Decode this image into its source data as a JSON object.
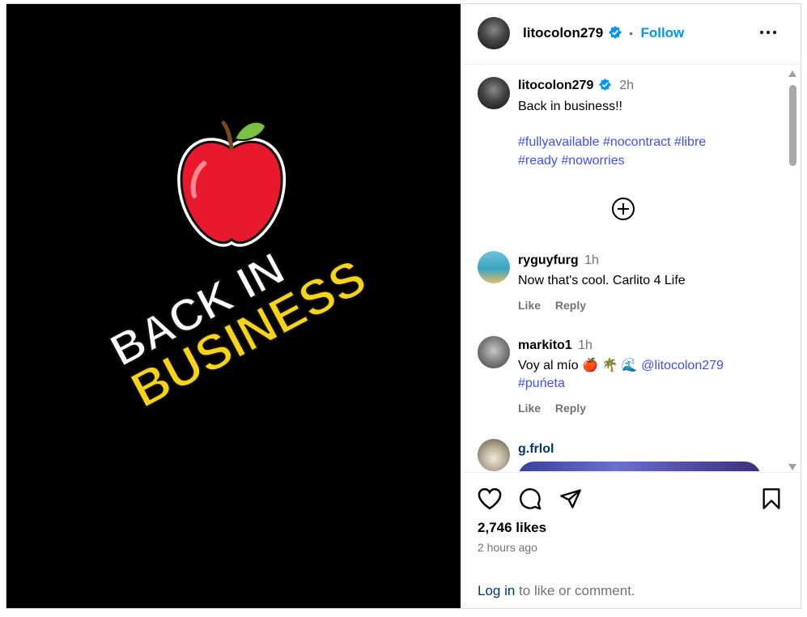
{
  "post": {
    "image_text_line1": "BACK IN",
    "image_text_line2": "BUSINESS"
  },
  "header": {
    "username": "litocolon279",
    "separator": "•",
    "follow_label": "Follow"
  },
  "caption": {
    "username": "litocolon279",
    "time": "2h",
    "text": "Back in business!!",
    "hashtags_line1": [
      "#fullyavailable",
      "#nocontract",
      "#libre"
    ],
    "hashtags_line2": [
      "#ready",
      "#noworries"
    ]
  },
  "comments": [
    {
      "username": "ryguyfurg",
      "time": "1h",
      "text": "Now that's cool. Carlito 4 Life",
      "like_label": "Like",
      "reply_label": "Reply"
    },
    {
      "username": "markito1",
      "time": "1h",
      "text_prefix": "Voy al mío",
      "emojis": "🍎 🌴 🌊",
      "mention": "@litocolon279",
      "hashtag": "#puńeta",
      "like_label": "Like",
      "reply_label": "Reply"
    },
    {
      "username": "g.frlol"
    }
  ],
  "footer": {
    "likes": "2,746 likes",
    "time_ago": "2 hours ago",
    "login_link": "Log in",
    "login_rest": " to like or comment."
  },
  "colors": {
    "accent": "#0095f6",
    "hashtag": "#4150f7",
    "verified": "#0095f6",
    "apple": "#e8192c",
    "business_text": "#f7d417"
  }
}
